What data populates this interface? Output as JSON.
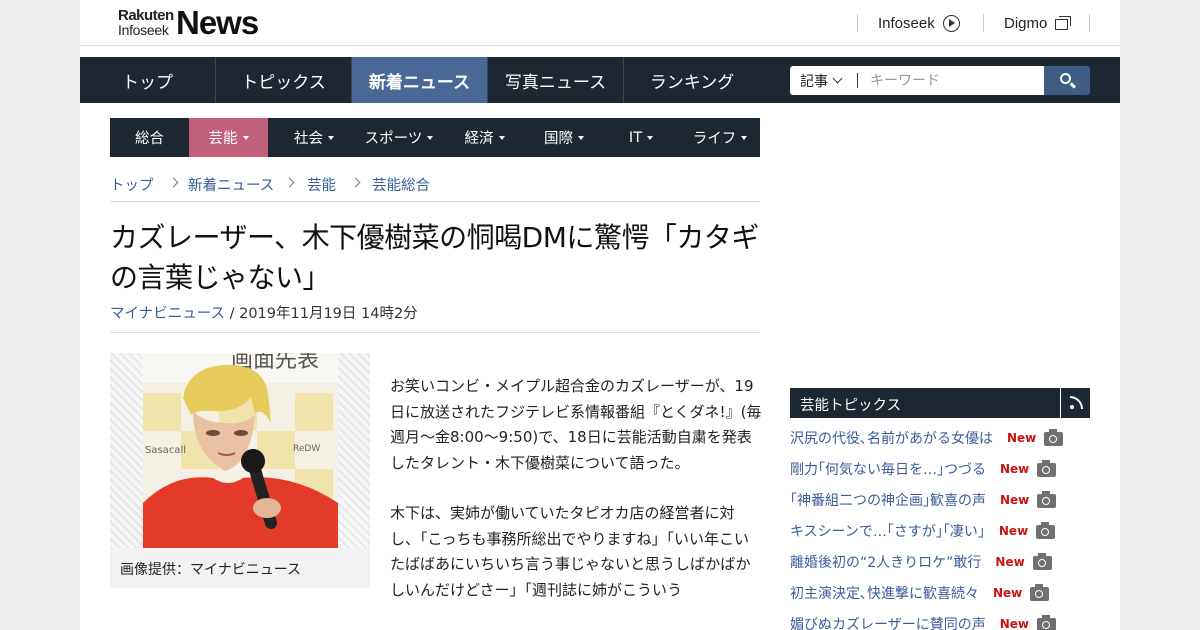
{
  "logo": {
    "rakuten": "Rakuten",
    "infoseek": "Infoseek",
    "news": "News"
  },
  "toplinks": [
    {
      "label": "Infoseek",
      "icon": "circle-arrow-icon"
    },
    {
      "label": "Digmo",
      "icon": "window-icon"
    }
  ],
  "main_nav": [
    {
      "label": "トップ",
      "active": false
    },
    {
      "label": "トピックス",
      "active": false
    },
    {
      "label": "新着ニュース",
      "active": true
    },
    {
      "label": "写真ニュース",
      "active": false
    },
    {
      "label": "ランキング",
      "active": false
    }
  ],
  "search": {
    "scope": "記事",
    "placeholder": "キーワード",
    "icon": "search-icon"
  },
  "categories": [
    {
      "label": "総合",
      "dropdown": false,
      "active": false
    },
    {
      "label": "芸能",
      "dropdown": true,
      "active": true
    },
    {
      "label": "社会",
      "dropdown": true,
      "active": false
    },
    {
      "label": "スポーツ",
      "dropdown": true,
      "active": false
    },
    {
      "label": "経済",
      "dropdown": true,
      "active": false
    },
    {
      "label": "国際",
      "dropdown": true,
      "active": false
    },
    {
      "label": "IT",
      "dropdown": true,
      "active": false
    },
    {
      "label": "ライフ",
      "dropdown": true,
      "active": false
    }
  ],
  "breadcrumb": [
    "トップ",
    "新着ニュース",
    "芸能",
    "芸能総合"
  ],
  "article": {
    "title": "カズレーザー、木下優樹菜の恫喝DMに驚愕「カタギの言葉じゃない」",
    "source": "マイナビニュース",
    "date": " / 2019年11月19日 14時2分",
    "image_caption": "画像提供：マイナビニュース",
    "paragraphs": [
      "お笑いコンビ・メイプル超合金のカズレーザーが、19日に放送されたフジテレビ系情報番組『とくダネ!』(毎週月～金8:00～9:50)で、18日に芸能活動自粛を発表したタレント・木下優樹菜について語った。",
      "木下は、実姉が働いていたタピオカ店の経営者に対し、「こっちも事務所総出でやりますね」「いい年こいたばばあにいちいち言う事じゃないと思うしばかばかしいんだけどさー」「週刊誌に姉がこういう"
    ]
  },
  "sidebar": {
    "heading": "芸能トピックス",
    "rss_icon": "rss-icon",
    "topics": [
      {
        "text": "沢尻の代役､名前があがる女優は",
        "new": "New"
      },
      {
        "text": "剛力｢何気ない毎日を…｣つづる",
        "new": "New"
      },
      {
        "text": "｢神番組二つの神企画｣歓喜の声",
        "new": "New"
      },
      {
        "text": "キスシーンで…｢さすが｣｢凄い｣",
        "new": "New"
      },
      {
        "text": "離婚後初の“2人きりロケ”敢行",
        "new": "New"
      },
      {
        "text": "初主演決定､快進撃に歓喜続々",
        "new": "New"
      },
      {
        "text": "媚びぬカズレーザーに賛同の声",
        "new": "New"
      }
    ]
  },
  "colors": {
    "nav_bg": "#1c2732",
    "nav_active": "#4a6896",
    "category_active": "#c0607a",
    "link": "#3a5c9a",
    "new_badge": "#c91414"
  }
}
